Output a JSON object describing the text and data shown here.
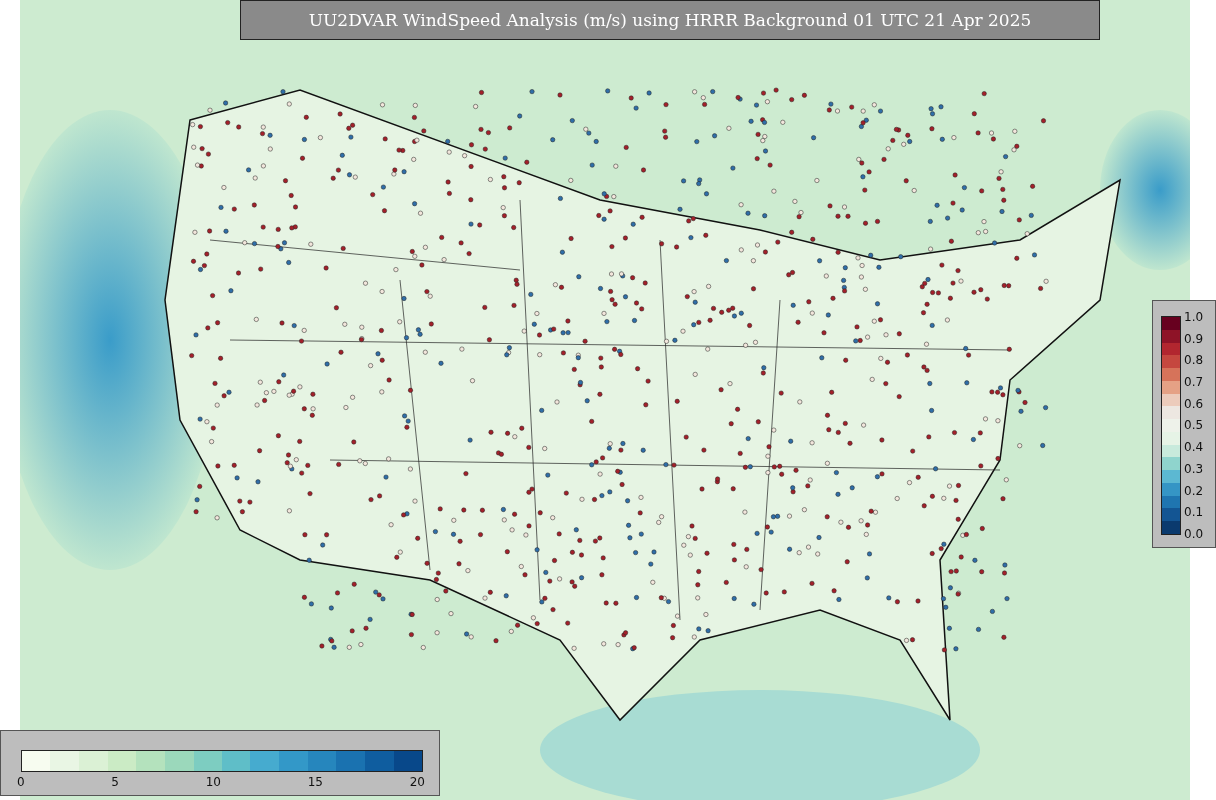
{
  "title": "UU2DVAR WindSpeed Analysis (m/s) using HRRR Background 01 UTC 21 Apr 2025",
  "ratio_colorbar": {
    "ticks": [
      "1.0",
      "0.9",
      "0.8",
      "0.7",
      "0.6",
      "0.5",
      "0.4",
      "0.3",
      "0.2",
      "0.1",
      "0.0"
    ]
  },
  "speed_colorbar": {
    "ticks": [
      "0",
      "5",
      "10",
      "15",
      "20"
    ]
  }
}
